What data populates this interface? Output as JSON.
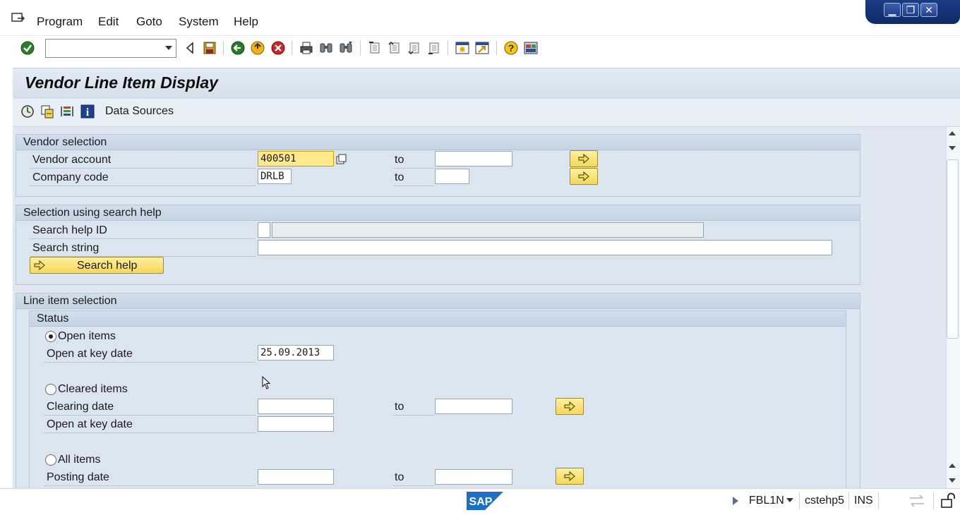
{
  "menu": {
    "items": [
      "Program",
      "Edit",
      "Goto",
      "System",
      "Help"
    ]
  },
  "window_controls": {
    "minimize": "▁",
    "maximize": "❐",
    "close": "✕"
  },
  "toolbar": {
    "command_field_value": "",
    "icons": [
      "enter-check-icon",
      "back-triangle-icon",
      "save-icon",
      "back-icon",
      "exit-icon",
      "cancel-icon",
      "print-icon",
      "find-icon",
      "find-next-icon",
      "first-page-icon",
      "previous-page-icon",
      "next-page-icon",
      "last-page-icon",
      "create-session-icon",
      "shortcut-icon",
      "help-icon",
      "customize-layout-icon"
    ]
  },
  "page": {
    "title": "Vendor Line Item Display",
    "app_toolbar": {
      "icons": [
        "execute-icon",
        "get-variant-icon",
        "dynamic-selections-icon",
        "info-icon"
      ],
      "data_sources_label": "Data Sources"
    }
  },
  "vendor_selection": {
    "title": "Vendor selection",
    "vendor_account_label": "Vendor account",
    "vendor_account_value": "400501",
    "vendor_account_to_label": "to",
    "vendor_account_to_value": "",
    "company_code_label": "Company code",
    "company_code_value": "DRLB",
    "company_code_to_label": "to",
    "company_code_to_value": ""
  },
  "search_help_selection": {
    "title": "Selection using search help",
    "search_help_id_label": "Search help ID",
    "search_help_id_value": "",
    "search_help_desc_value": "",
    "search_string_label": "Search string",
    "search_string_value": "",
    "search_help_button": "Search help"
  },
  "line_item_selection": {
    "title": "Line item selection",
    "status_title": "Status",
    "open_items_label": "Open items",
    "open_items_selected": true,
    "open_at_key_date_label": "Open at key date",
    "open_at_key_date_value": "25.09.2013",
    "cleared_items_label": "Cleared items",
    "cleared_items_selected": false,
    "clearing_date_label": "Clearing date",
    "clearing_date_value": "",
    "clearing_date_to_label": "to",
    "clearing_date_to_value": "",
    "cleared_open_at_key_date_label": "Open at key date",
    "cleared_open_at_key_date_value": "",
    "all_items_label": "All items",
    "all_items_selected": false,
    "posting_date_label": "Posting date",
    "posting_date_value": "",
    "posting_date_to_label": "to",
    "posting_date_to_value": ""
  },
  "status_bar": {
    "logo_text": "SAP",
    "transaction": "FBL1N",
    "server": "cstehp5",
    "mode": "INS"
  }
}
